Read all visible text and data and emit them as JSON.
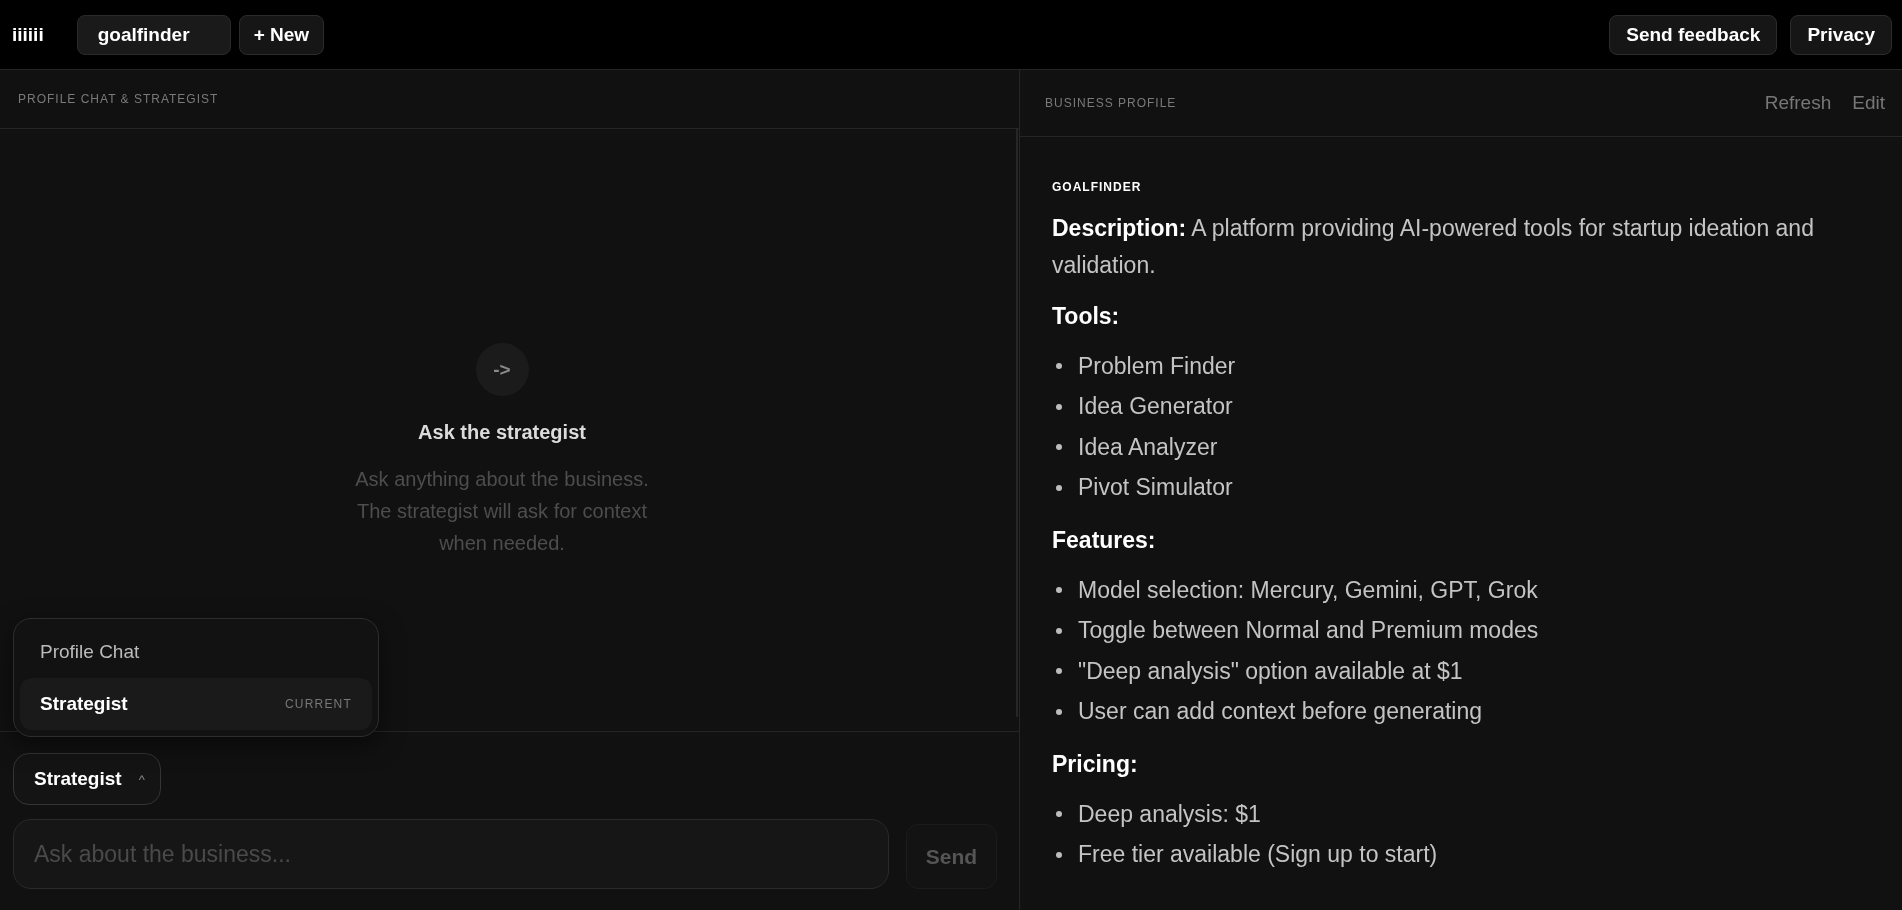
{
  "top_bar": {
    "logo": "iiiiii",
    "project_field": {
      "value": "goalfinder"
    },
    "new_button": "+ New",
    "actions": [
      "Send feedback",
      "Privacy"
    ]
  },
  "chat_panel": {
    "header": "PROFILE CHAT & STRATEGIST",
    "empty_state": {
      "icon": "->",
      "title": "Ask the strategist",
      "text": "Ask anything about the business. The strategist will ask for context when needed."
    },
    "mode_menu": [
      {
        "label": "Profile Chat",
        "selected": false
      },
      {
        "label": "Strategist",
        "selected": true,
        "tag": "CURRENT"
      }
    ],
    "mode_selector": {
      "label": "Strategist",
      "caret": "^",
      "expanded": true
    },
    "composer": {
      "placeholder": "Ask about the business...",
      "send": {
        "label": "Send",
        "disabled": true
      }
    }
  },
  "profile_panel": {
    "header": "BUSINESS PROFILE",
    "actions": [
      "Refresh",
      "Edit"
    ],
    "title": "GOALFINDER",
    "description": "**Description:** A platform providing AI-powered tools for startup ideation and validation.",
    "sections": [
      {
        "heading": "Tools:",
        "items": [
          "Problem Finder",
          "Idea Generator",
          "Idea Analyzer",
          "Pivot Simulator"
        ]
      },
      {
        "heading": "Features:",
        "items": [
          "Model selection: Mercury, Gemini, GPT, Grok",
          "Toggle between Normal and Premium modes",
          "\"Deep analysis\" option available at $1",
          "User can add context before generating"
        ]
      },
      {
        "heading": "Pricing:",
        "items": [
          "Deep analysis: $1",
          "Free tier available (Sign up to start)"
        ]
      }
    ]
  }
}
